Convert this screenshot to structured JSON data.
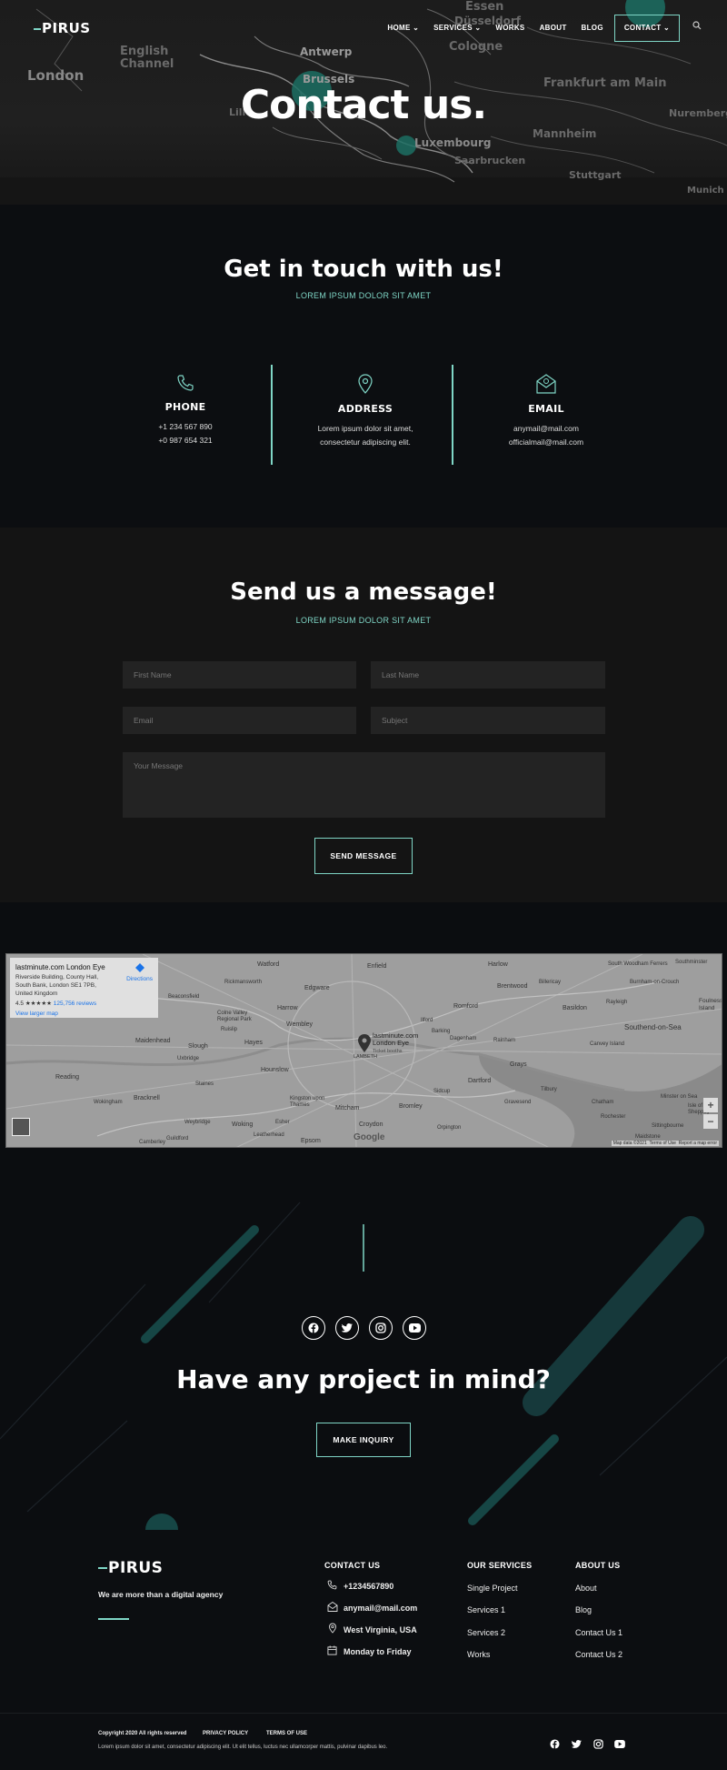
{
  "header": {
    "logo": "PIRUS",
    "nav": [
      {
        "label": "HOME",
        "has_dropdown": true
      },
      {
        "label": "SERVICES",
        "has_dropdown": true
      },
      {
        "label": "WORKS",
        "has_dropdown": false
      },
      {
        "label": "ABOUT",
        "has_dropdown": false
      },
      {
        "label": "BLOG",
        "has_dropdown": false
      },
      {
        "label": "CONTACT",
        "has_dropdown": true
      }
    ],
    "search_icon": "search-icon"
  },
  "hero": {
    "title": "Contact us.",
    "map_labels": [
      "Essen",
      "Düsseldorf",
      "Cologne",
      "Antwerp",
      "Brussels",
      "London",
      "English Channel",
      "Lille",
      "Luxembourg",
      "Saarbrucken",
      "Frankfurt am Main",
      "Mannheim",
      "Stuttgart",
      "Nuremberg",
      "Munich"
    ]
  },
  "touch": {
    "title": "Get in touch with us!",
    "subtitle": "LOREM IPSUM DOLOR SIT AMET",
    "columns": [
      {
        "icon": "phone-icon",
        "title": "PHONE",
        "lines": [
          "+1 234 567 890",
          "+0 987 654 321"
        ]
      },
      {
        "icon": "location-pin-icon",
        "title": "ADDRESS",
        "lines": [
          "Lorem ipsum dolor sit amet,",
          "consectetur adipiscing elit."
        ]
      },
      {
        "icon": "envelope-icon",
        "title": "EMAIL",
        "lines": [
          "anymail@mail.com",
          "officialmail@mail.com"
        ]
      }
    ]
  },
  "message": {
    "title": "Send us a message!",
    "subtitle": "LOREM IPSUM DOLOR SIT AMET",
    "placeholders": {
      "first_name": "First Name",
      "last_name": "Last Name",
      "email": "Email",
      "subject": "Subject",
      "message": "Your Message"
    },
    "button": "SEND MESSAGE"
  },
  "map": {
    "card_title": "lastminute.com London Eye",
    "card_address": "Riverside Building, County Hall, South Bank, London SE1 7PB, United Kingdom",
    "card_rating": "4.5 ★★★★★",
    "card_reviews": "125,756 reviews",
    "card_directions": "Directions",
    "card_larger": "View larger map",
    "pin_label": "lastminute.com London Eye",
    "pin_sub": "Ticket booths",
    "labels": [
      "Watford",
      "Enfield",
      "Harlow",
      "South Woodham Ferrers",
      "Southminster",
      "Burnham-on-Crouch",
      "Foulness Island",
      "Southend-on-Sea",
      "Basildon",
      "Rayleigh",
      "Billericay",
      "Brentwood",
      "Romford",
      "Edgware",
      "Harrow",
      "Wembley",
      "Hayes",
      "Slough",
      "Maidenhead",
      "Reading",
      "Hounslow",
      "Bracknell",
      "Woking",
      "Kingston upon Thames",
      "Mitcham",
      "Croydon",
      "Bromley",
      "Sidcup",
      "Dartford",
      "Grays",
      "Chatham",
      "Rochester",
      "Maidstone",
      "Epsom",
      "Leatherhead",
      "Camberley",
      "Colne Valley Regional Park",
      "Beaconsfield",
      "Rickmansworth",
      "Ruislip",
      "Uxbridge",
      "Staines",
      "Esher",
      "Weybridge",
      "Tilbury",
      "Gravesend",
      "Sittingbourne",
      "Minster on Sea",
      "Isle of Sheppey",
      "Barking",
      "Dagenham",
      "Rainham",
      "Canvey Island",
      "LAMBETH",
      "Ilford",
      "Wokingham",
      "Orpington",
      "Guildford"
    ],
    "google": "Google",
    "footer_text": [
      "Map data ©2021",
      "Terms of Use",
      "Report a map error"
    ]
  },
  "project": {
    "title": "Have any project in mind?",
    "button": "MAKE INQUIRY",
    "social": [
      "facebook-icon",
      "twitter-icon",
      "instagram-icon",
      "youtube-icon"
    ]
  },
  "footer": {
    "logo": "PIRUS",
    "tagline": "We are more than a digital agency",
    "contact_head": "CONTACT US",
    "contact": [
      {
        "icon": "phone-icon",
        "text": "+1234567890"
      },
      {
        "icon": "envelope-icon",
        "text": "anymail@mail.com"
      },
      {
        "icon": "location-pin-icon",
        "text": "West Virginia, USA"
      },
      {
        "icon": "calendar-icon",
        "text": "Monday to Friday"
      }
    ],
    "services_head": "OUR SERVICES",
    "services": [
      "Single Project",
      "Services 1",
      "Services 2",
      "Works"
    ],
    "about_head": "ABOUT US",
    "about": [
      "About",
      "Blog",
      "Contact Us 1",
      "Contact Us 2"
    ],
    "copyright": "Copyright 2020 All rights reserved",
    "privacy": "PRIVACY POLICY",
    "terms": "TERMS OF USE",
    "lorem": "Lorem ipsum dolor sit amet, consectetur adipiscing elit. Ut elit tellus, luctus nec ullamcorper mattis, pulvinar dapibus leo.",
    "social": [
      "facebook-icon",
      "twitter-icon",
      "instagram-icon",
      "youtube-icon"
    ]
  },
  "colors": {
    "accent": "#7fd6c6",
    "background": "#0b0d10",
    "form_bg": "#141414",
    "input_bg": "#232323"
  }
}
